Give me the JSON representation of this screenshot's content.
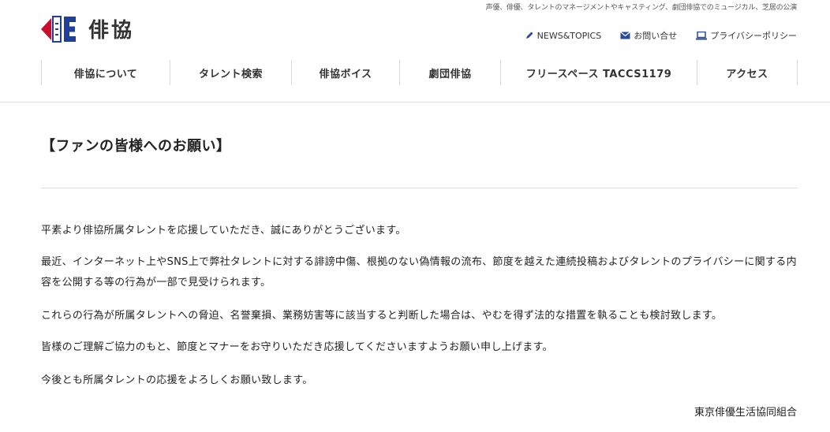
{
  "header": {
    "tagline": "声優、俳優、タレントのマネージメントやキャスティング、劇団俳協でのミュージカル、芝居の公演",
    "logo_text": "俳協",
    "colors": {
      "logo_red": "#c8102e",
      "logo_blue": "#1f3f99",
      "icon_blue": "#2a4a9a"
    },
    "links": [
      {
        "icon": "pencil-icon",
        "label": "NEWS&TOPICS"
      },
      {
        "icon": "mail-icon",
        "label": "お問い合せ"
      },
      {
        "icon": "laptop-icon",
        "label": "プライバシーポリシー"
      }
    ]
  },
  "nav": {
    "items": [
      {
        "label": "俳協について"
      },
      {
        "label": "タレント検索"
      },
      {
        "label": "俳協ボイス"
      },
      {
        "label": "劇団俳協"
      },
      {
        "label": "フリースペース TACCS1179"
      },
      {
        "label": "アクセス"
      }
    ]
  },
  "main": {
    "title": "【ファンの皆様へのお願い】",
    "paragraphs": [
      "平素より俳協所属タレントを応援していただき、誠にありがとうございます。",
      "最近、インターネット上やSNS上で弊社タレントに対する誹謗中傷、根拠のない偽情報の流布、節度を越えた連続投稿およびタレントのプライバシーに関する内容を公開する等の行為が一部で見受けられます。",
      "これらの行為が所属タレントへの脅迫、名誉棄損、業務妨害等に該当すると判断した場合は、やむを得ず法的な措置を執ることも検討致します。",
      "皆様のご理解ご協力のもと、節度とマナーをお守りいただき応援してくださいますようお願い申し上げます。",
      "今後とも所属タレントの応援をよろしくお願い致します。"
    ],
    "signature": "東京俳優生活協同組合"
  }
}
